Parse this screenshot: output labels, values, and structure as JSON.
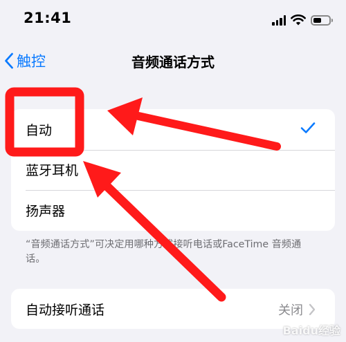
{
  "status_bar": {
    "time": "21:41",
    "icons": [
      "cellular-signal-icon",
      "wifi-icon",
      "battery-icon"
    ]
  },
  "nav": {
    "back_label": "触控",
    "title": "音频通话方式"
  },
  "options": [
    {
      "label": "自动",
      "selected": true
    },
    {
      "label": "蓝牙耳机",
      "selected": false
    },
    {
      "label": "扬声器",
      "selected": false
    }
  ],
  "footnote": "“音频通话方式”可决定用哪种方式接听电话或FaceTime 音频通话。",
  "auto_answer": {
    "label": "自动接听通话",
    "value": "关闭"
  },
  "colors": {
    "accent": "#0a7aff",
    "annotation_red": "#ff1a1a",
    "background": "#f2f2f7"
  },
  "watermark": "Baidu经验"
}
